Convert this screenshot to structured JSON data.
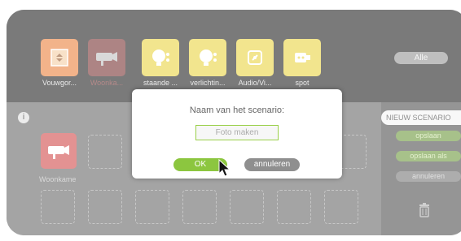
{
  "devices": [
    {
      "label": "Vouwgor..."
    },
    {
      "label": "Woonka..."
    },
    {
      "label": "staande ..."
    },
    {
      "label": "verlichtin..."
    },
    {
      "label": "Audio/Vi..."
    },
    {
      "label": "spot"
    }
  ],
  "filter": {
    "label": "Alle"
  },
  "scenario_slot": {
    "label": "Woonkame"
  },
  "info_icon": {
    "label": "i"
  },
  "right_panel": {
    "header": "NIEUW SCENARIO",
    "save": "opslaan",
    "save_as": "opslaan als",
    "cancel": "annuleren"
  },
  "dialog": {
    "title": "Naam van het scenario:",
    "input_value": "Foto maken",
    "ok": "OK",
    "cancel": "annuleren"
  },
  "colors": {
    "orange": "#e8752a",
    "red": "#cc3a3a",
    "yellow": "#e8cf32",
    "green": "#8cc63f",
    "grey": "#8f8f8f"
  }
}
